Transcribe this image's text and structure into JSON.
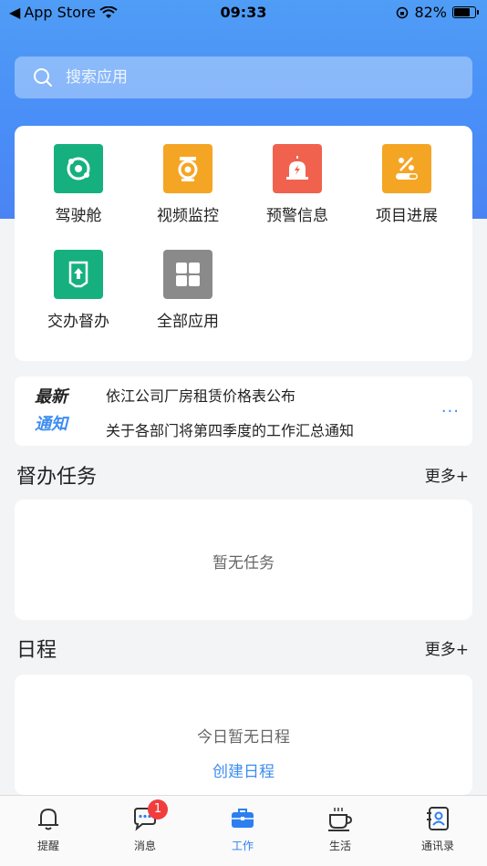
{
  "status_bar": {
    "back_label": "App Store",
    "time": "09:33",
    "battery": "82%",
    "battery_level": 0.82
  },
  "search": {
    "placeholder": "搜索应用"
  },
  "apps": [
    {
      "label": "驾驶舱",
      "color": "#16b07e",
      "icon": "cockpit-icon"
    },
    {
      "label": "视频监控",
      "color": "#f5a524",
      "icon": "camera-icon"
    },
    {
      "label": "预警信息",
      "color": "#f0624d",
      "icon": "alarm-icon"
    },
    {
      "label": "项目进展",
      "color": "#f5a524",
      "icon": "progress-icon"
    },
    {
      "label": "交办督办",
      "color": "#16b07e",
      "icon": "assign-icon"
    },
    {
      "label": "全部应用",
      "color": "#8a8a8a",
      "icon": "grid-icon"
    }
  ],
  "notice": {
    "badge_line1": "最新",
    "badge_line2": "通知",
    "items": [
      "依江公司厂房租赁价格表公布",
      "关于各部门将第四季度的工作汇总通知"
    ],
    "more": "···"
  },
  "tasks": {
    "title": "督办任务",
    "more": "更多+",
    "empty": "暂无任务"
  },
  "schedule": {
    "title": "日程",
    "more": "更多+",
    "empty": "今日暂无日程",
    "create": "创建日程"
  },
  "tabs": [
    {
      "label": "提醒",
      "icon": "bell-icon"
    },
    {
      "label": "消息",
      "icon": "chat-icon",
      "badge": "1"
    },
    {
      "label": "工作",
      "icon": "briefcase-icon",
      "active": true
    },
    {
      "label": "生活",
      "icon": "coffee-icon"
    },
    {
      "label": "通讯录",
      "icon": "contacts-icon"
    }
  ],
  "colors": {
    "accent": "#2d7ff0",
    "hero": "#4a8ef7",
    "badge": "#f23d3d"
  }
}
